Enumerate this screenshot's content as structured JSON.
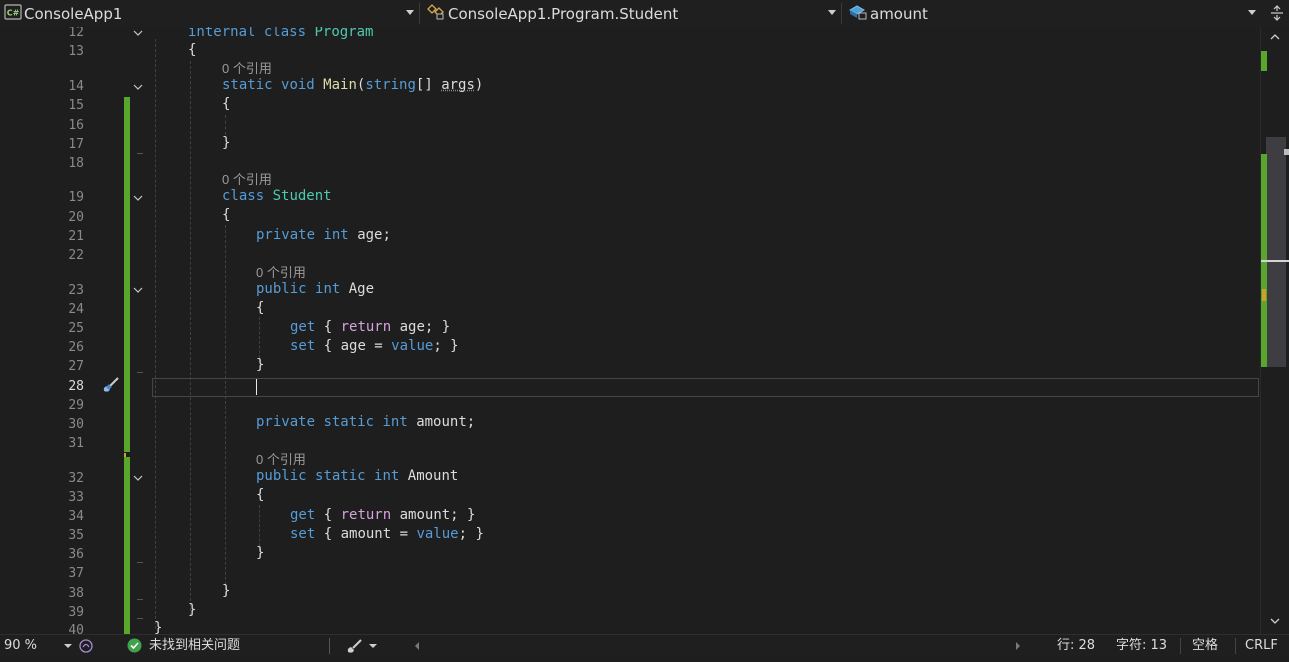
{
  "navbar": {
    "project": {
      "icon": "csharp-project-icon",
      "label": "ConsoleApp1"
    },
    "type": {
      "icon": "class-icon",
      "label": "ConsoleApp1.Program.Student"
    },
    "member": {
      "icon": "field-icon",
      "label": "amount"
    }
  },
  "editor": {
    "line_numbers": [
      "12",
      "13",
      "14",
      "15",
      "16",
      "17",
      "18",
      "19",
      "20",
      "21",
      "22",
      "23",
      "24",
      "25",
      "26",
      "27",
      "28",
      "29",
      "30",
      "31",
      "32",
      "33",
      "34",
      "35",
      "36",
      "37",
      "38",
      "39",
      "40"
    ],
    "current_line": "28",
    "codelens": "0 个引用",
    "code": {
      "l12": [
        "internal",
        "class",
        "Program"
      ],
      "l13": "{",
      "l14": [
        "static",
        "void",
        "Main",
        "(",
        "string",
        "[] ",
        "args",
        ")"
      ],
      "l15": "{",
      "l17": "}",
      "l19": [
        "class",
        "Student"
      ],
      "l20": "{",
      "l21": [
        "private",
        "int",
        "age;"
      ],
      "l23": [
        "public",
        "int",
        "Age"
      ],
      "l24": "{",
      "l25": [
        "get",
        "{ ",
        "return",
        " age; }"
      ],
      "l26": [
        "set",
        "{ age = ",
        "value",
        "; }"
      ],
      "l27": "}",
      "l30": [
        "private",
        "static",
        "int",
        "amount;"
      ],
      "l32": [
        "public",
        "static",
        "int",
        "Amount"
      ],
      "l33": "{",
      "l34": [
        "get",
        "{ ",
        "return",
        " amount; }"
      ],
      "l35": [
        "set",
        "{ amount = ",
        "value",
        "; }"
      ],
      "l36": "}",
      "l38": "}",
      "l39": "}",
      "l40": "}"
    }
  },
  "statusbar": {
    "zoom": "90 %",
    "issues": "未找到相关问题",
    "line": "行: 28",
    "char": "字符: 13",
    "indent": "空格",
    "eol": "CRLF"
  },
  "colors": {
    "keyword": "#569cd6",
    "control": "#d8a0df",
    "type": "#4ec9b0",
    "method": "#dcdcaa",
    "changed": "#58a62c"
  }
}
